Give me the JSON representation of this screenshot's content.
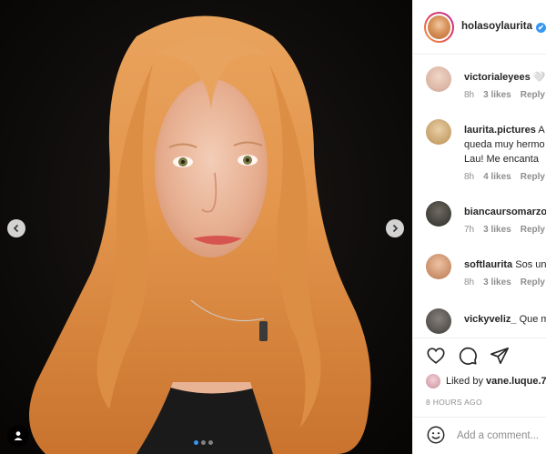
{
  "post": {
    "owner_username": "holasoylaurita",
    "verified_mark": "✔",
    "carousel_dots": 3,
    "active_dot": 0
  },
  "comments": [
    {
      "username": "victorialeyees",
      "text": "🤍🤍",
      "time": "8h",
      "likes": "3 likes",
      "reply": "Reply",
      "avatar_color": "#d9b8a9"
    },
    {
      "username": "laurita.pictures",
      "text": "A",
      "text_line2": "queda muy hermo",
      "text_line3": "Lau! Me encanta",
      "time": "8h",
      "likes": "4 likes",
      "reply": "Reply",
      "avatar_color": "#c9a36e"
    },
    {
      "username": "biancaursomarzo",
      "text": "",
      "time": "7h",
      "likes": "3 likes",
      "reply": "Reply",
      "avatar_color": "#3b3a36"
    },
    {
      "username": "softlaurita",
      "text": "Sos un",
      "time": "8h",
      "likes": "3 likes",
      "reply": "Reply",
      "avatar_color": "#d8a07c"
    },
    {
      "username": "vickyveliz_",
      "text": "Que m",
      "avatar_color": "#4c4a48"
    }
  ],
  "likes": {
    "prefix": "Liked by ",
    "user": "vane.luque.7"
  },
  "timestamp": "8 HOURS AGO",
  "add_comment": {
    "placeholder": "Add a comment..."
  },
  "icons": [
    "heart-icon",
    "comment-icon",
    "share-icon",
    "emoji-icon",
    "chevron-left-icon",
    "chevron-right-icon",
    "tag-user-icon",
    "verified-icon"
  ],
  "colors": {
    "accent": "#3897f0",
    "border": "#efefef",
    "muted": "#8e8e8e",
    "text": "#262626"
  }
}
